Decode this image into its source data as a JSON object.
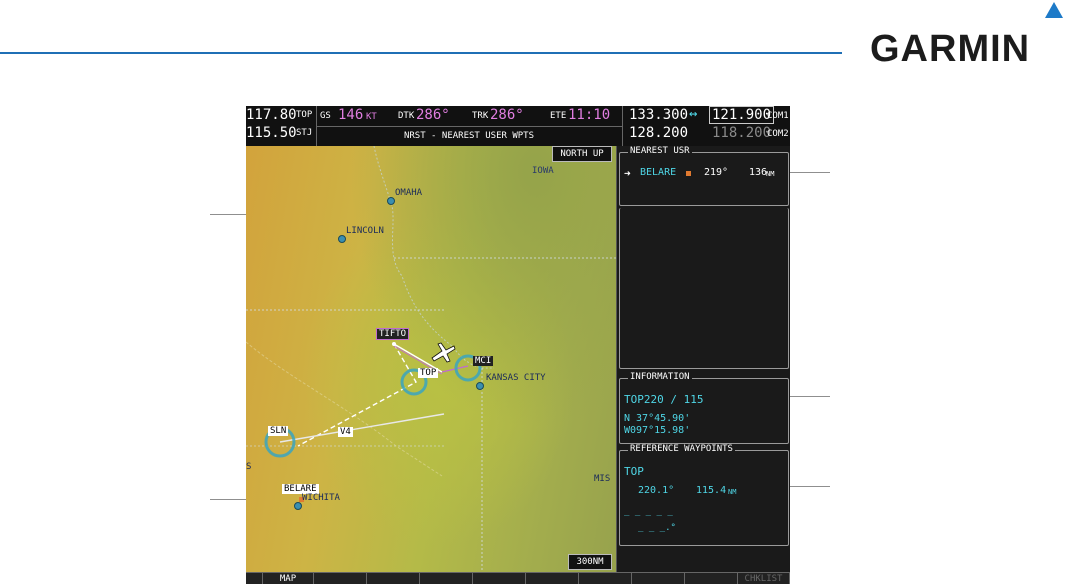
{
  "brand": {
    "name": "GARMIN"
  },
  "nav": {
    "nav1_freq": "117.80",
    "nav1_id": "TOP",
    "nav2_freq": "115.50",
    "nav2_id": "STJ",
    "gs_label": "GS",
    "gs_value": "146",
    "gs_unit": "KT",
    "dtk_label": "DTK",
    "dtk_value": "286°",
    "trk_label": "TRK",
    "trk_value": "286°",
    "ete_label": "ETE",
    "ete_value": "11:10",
    "page_title": "NRST - NEAREST USER WPTS",
    "com1_standby": "133.300",
    "swap_symbol": "↔",
    "com1_active": "121.900",
    "com1_label": "COM1",
    "com2_standby": "128.200",
    "com2_active": "118.200",
    "com2_label": "COM2"
  },
  "map": {
    "north_up": "NORTH UP",
    "scale": "300NM",
    "labels": {
      "iowa": "IOWA",
      "omaha": "OMAHA",
      "lincoln": "LINCOLN",
      "tifto": "TIFTO",
      "mci": "MCI",
      "kansas_city": "KANSAS CITY",
      "top": "TOP",
      "sln": "SLN",
      "v4": "V4",
      "belare": "BELARE",
      "wichita": "WICHITA",
      "mis": "MIS",
      "s": "S"
    }
  },
  "nearest": {
    "title": "NEAREST USR",
    "row": {
      "arrow": "➜",
      "ident": "BELARE",
      "bearing": "219°",
      "distance": "136",
      "unit": "NM"
    },
    "colors": {
      "marker": "#e07a30"
    }
  },
  "information": {
    "title": "INFORMATION",
    "radial": "TOP220 / 115",
    "lat": "N 37°45.90'",
    "lon": "W097°15.98'"
  },
  "reference": {
    "title": "REFERENCE WAYPOINTS",
    "ident": "TOP",
    "bearing": "220.1°",
    "distance": "115.4",
    "unit": "NM",
    "blank_ident": "_ _ _ _ _",
    "blank_values": "_ _ _.° "
  },
  "softkeys": [
    {
      "label": ""
    },
    {
      "label": "MAP"
    },
    {
      "label": ""
    },
    {
      "label": ""
    },
    {
      "label": ""
    },
    {
      "label": ""
    },
    {
      "label": ""
    },
    {
      "label": ""
    },
    {
      "label": ""
    },
    {
      "label": ""
    },
    {
      "label": "CHKLIST"
    }
  ]
}
